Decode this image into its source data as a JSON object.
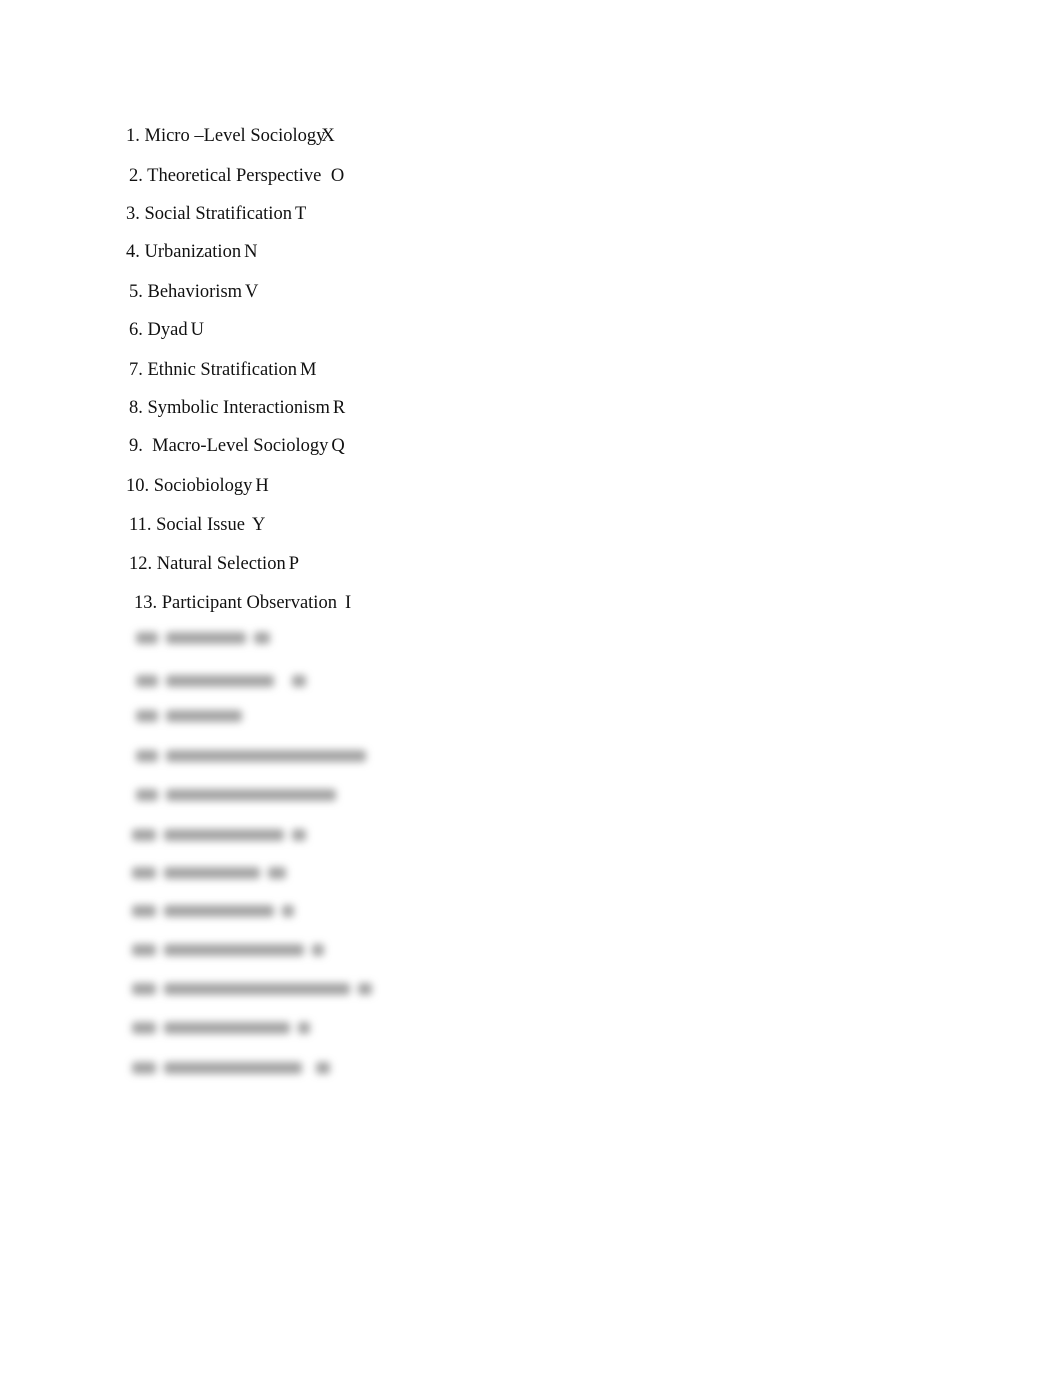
{
  "document": {
    "items": [
      {
        "number": "1.",
        "term": "Micro –Level Sociology",
        "answer": "X"
      },
      {
        "number": "2.",
        "term": "Theoretical Perspective ",
        "answer": "O"
      },
      {
        "number": "3.",
        "term": "Social Stratification",
        "answer": "T"
      },
      {
        "number": "4.",
        "term": "Urbanization",
        "answer": "N"
      },
      {
        "number": "5.",
        "term": "Behaviorism",
        "answer": "V"
      },
      {
        "number": "6.",
        "term": "Dyad",
        "answer": "U"
      },
      {
        "number": "7.",
        "term": "Ethnic Stratification",
        "answer": "M"
      },
      {
        "number": "8.",
        "term": "Symbolic Interactionism",
        "answer": "R"
      },
      {
        "number": "9. ",
        "term": "Macro-Level Sociology",
        "answer": "Q"
      },
      {
        "number": "10.",
        "term": "Sociobiology",
        "answer": "H"
      },
      {
        "number": "11.",
        "term": "Social Issue",
        "answer": "Y"
      },
      {
        "number": "12.",
        "term": "Natural Selection",
        "answer": "P"
      },
      {
        "number": "13.",
        "term": "Participant Observation",
        "answer": "I"
      }
    ],
    "blurred_item_count": 12
  }
}
